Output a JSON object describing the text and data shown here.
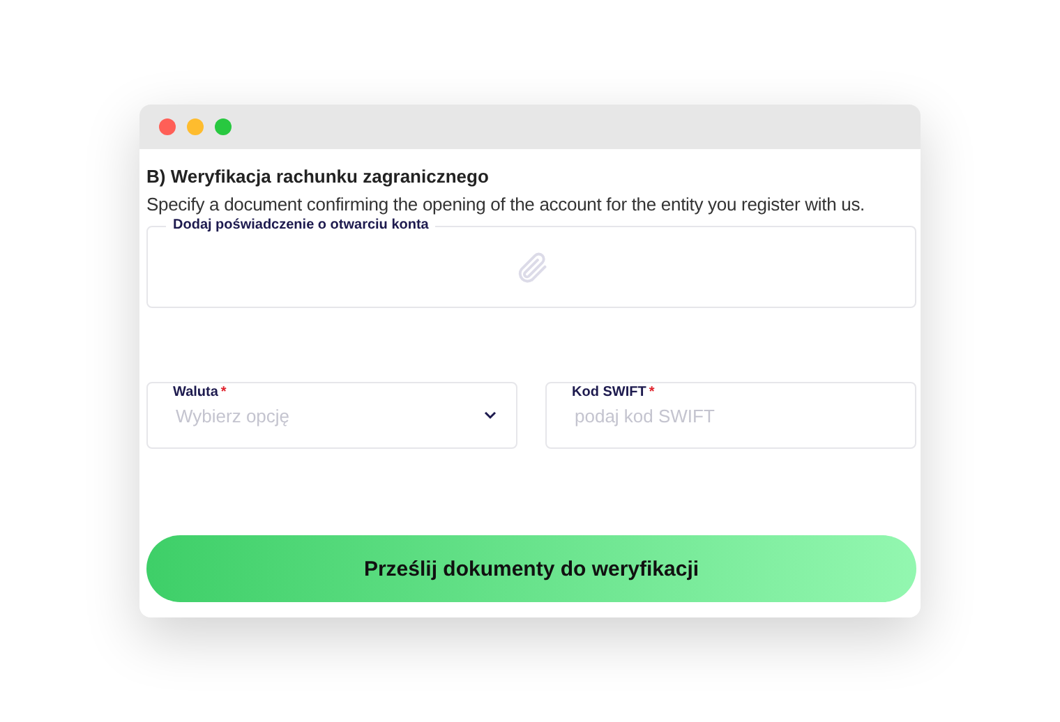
{
  "window": {
    "title_buttons": [
      {
        "color": "#ff5f57"
      },
      {
        "color": "#febc2e"
      },
      {
        "color": "#28c840"
      }
    ]
  },
  "heading": "B) Weryfikacja rachunku zagranicznego",
  "description": "Specify a document confirming the opening of the account for the entity you register with us.",
  "upload": {
    "label": "Dodaj poświadczenie o otwarciu konta"
  },
  "fields": [
    {
      "kind": "select",
      "label": "Waluta",
      "required_mark": "*",
      "placeholder": "Wybierz opcję"
    },
    {
      "kind": "text",
      "label": "Kod SWIFT",
      "required_mark": "*",
      "placeholder": "podaj kod SWIFT"
    }
  ],
  "submit": "Prześlij dokumenty do weryfikacji"
}
